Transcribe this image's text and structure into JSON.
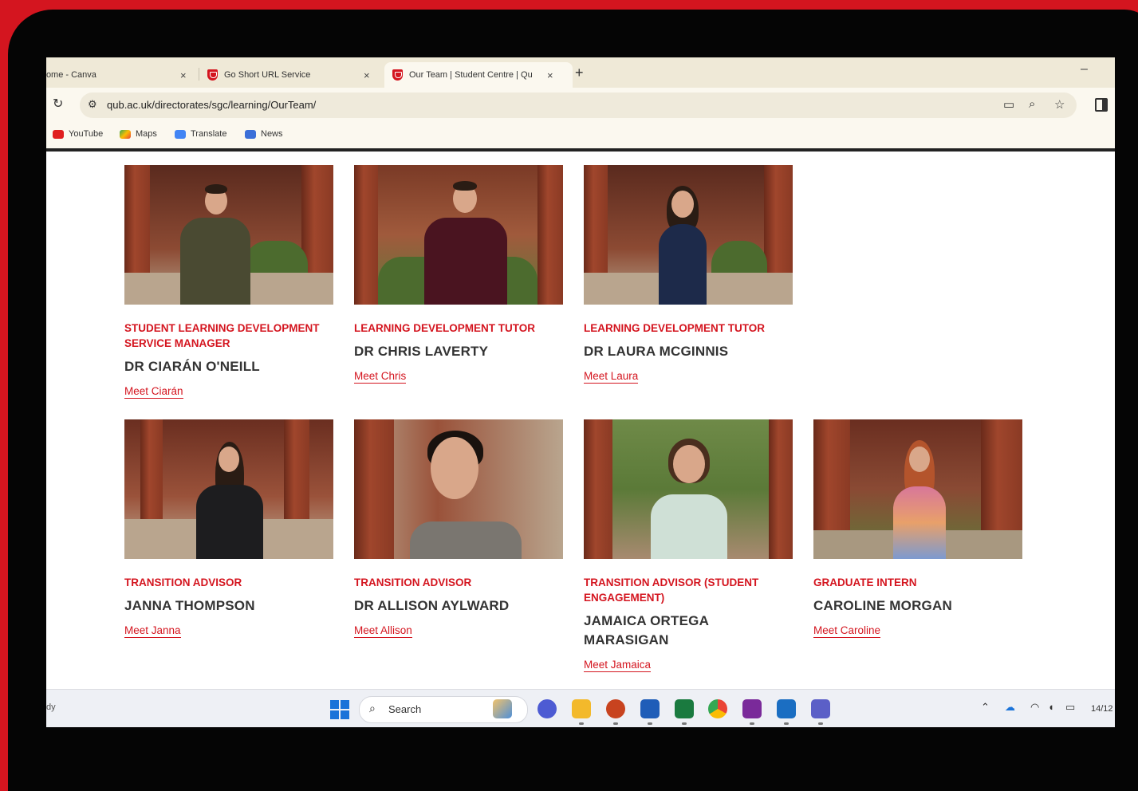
{
  "browser": {
    "tabs": [
      {
        "title": "Home - Canva",
        "close": "×"
      },
      {
        "title": "Go Short URL Service",
        "close": "×"
      },
      {
        "title": "Our Team | Student Centre | Qu",
        "close": "×"
      }
    ],
    "new_tab": "+",
    "minimize": "–",
    "url": "qub.ac.uk/directorates/sgc/learning/OurTeam/",
    "bookmarks": [
      "YouTube",
      "Maps",
      "Translate",
      "News"
    ]
  },
  "team": [
    {
      "role": "STUDENT LEARNING DEVELOPMENT SERVICE MANAGER",
      "name": "DR CIARÁN O'NEILL",
      "link": "Meet Ciarán"
    },
    {
      "role": "LEARNING DEVELOPMENT TUTOR",
      "name": "DR CHRIS LAVERTY",
      "link": "Meet Chris"
    },
    {
      "role": "LEARNING DEVELOPMENT TUTOR",
      "name": "DR LAURA MCGINNIS",
      "link": "Meet Laura"
    },
    {
      "role": "TRANSITION ADVISOR",
      "name": "JANNA THOMPSON",
      "link": "Meet Janna"
    },
    {
      "role": "TRANSITION ADVISOR",
      "name": "DR ALLISON AYLWARD",
      "link": "Meet Allison"
    },
    {
      "role": "TRANSITION ADVISOR (STUDENT ENGAGEMENT)",
      "name": "JAMAICA ORTEGA MARASIGAN",
      "link": "Meet Jamaica"
    },
    {
      "role": "GRADUATE INTERN",
      "name": "CAROLINE MORGAN",
      "link": "Meet Caroline"
    }
  ],
  "taskbar": {
    "left_text": "dy",
    "search_label": "Search",
    "time": "14/12"
  },
  "colors": {
    "accent": "#d4151f",
    "text": "#333333"
  }
}
